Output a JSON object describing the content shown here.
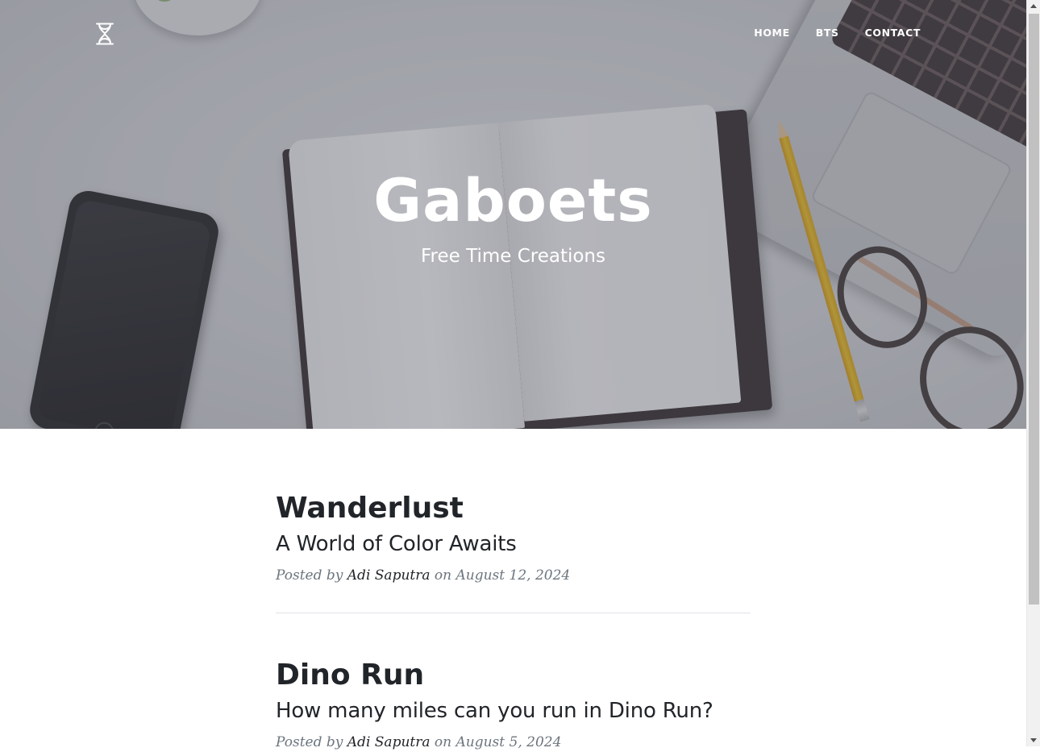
{
  "header": {
    "logo_icon": "hourglass-icon",
    "nav": [
      {
        "label": "HOME"
      },
      {
        "label": "BTS"
      },
      {
        "label": "CONTACT"
      }
    ]
  },
  "hero": {
    "title": "Gaboets",
    "subtitle": "Free Time Creations",
    "background": "desk-photo-notebook-phone-laptop-glasses",
    "overlay_color": "#545662"
  },
  "posts": [
    {
      "title": "Wanderlust",
      "subtitle": "A World of Color Awaits",
      "meta_prefix": "Posted by",
      "author": "Adi Saputra",
      "meta_on": "on",
      "date": "August 12, 2024"
    },
    {
      "title": "Dino Run",
      "subtitle": "How many miles can you run in Dino Run?",
      "meta_prefix": "Posted by",
      "author": "Adi Saputra",
      "meta_on": "on",
      "date": "August 5, 2024"
    }
  ],
  "colors": {
    "text_dark": "#212529",
    "text_muted": "#6c757d",
    "divider": "#dee2e6",
    "nav_text": "#ffffff"
  }
}
